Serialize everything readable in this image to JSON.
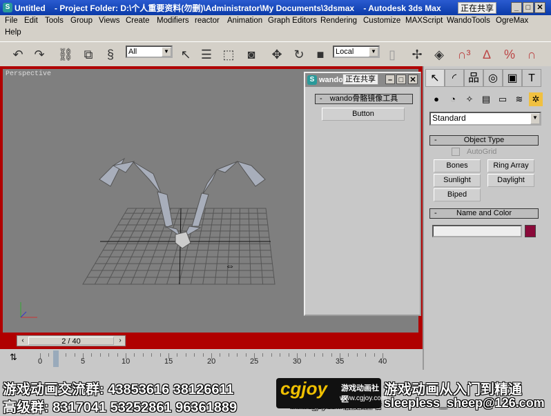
{
  "window": {
    "icon": "3ds-max-icon",
    "title": "Untitled    - Project Folder: D:\\个人重要资料(勿删)\\Administrator\\My Documents\\3dsmax    - Autodesk 3ds Max",
    "share_label": "正在共享"
  },
  "menu": [
    "File",
    "Edit",
    "Tools",
    "Group",
    "Views",
    "Create",
    "Modifiers",
    "reactor",
    "Animation",
    "Graph Editors",
    "Rendering",
    "Customize",
    "MAXScript",
    "WandoTools",
    "OgreMax",
    "Help"
  ],
  "toolbar": {
    "selection_filter": "All",
    "coord_system": "Local",
    "icons": [
      "undo-icon",
      "redo-icon",
      "link-icon",
      "unlink-icon",
      "bind-space-warp-icon",
      "select-icon",
      "select-by-name-icon",
      "rect-region-icon",
      "window-crossing-icon",
      "move-icon",
      "rotate-icon",
      "scale-icon",
      "pivot-icon",
      "manipulate-icon",
      "keyboard-shortcut-icon",
      "snap-3d-icon",
      "angle-snap-icon",
      "percent-snap-icon",
      "spinner-snap-icon"
    ]
  },
  "viewport": {
    "label": "Perspective",
    "frame_counter": "2 / 40",
    "border_color": "#b00000"
  },
  "floater": {
    "title": "wando",
    "share_label": "正在共享",
    "rollout": "wando骨骼镜像工具",
    "button": "Button"
  },
  "command_panel": {
    "dropdown": "Standard",
    "object_type": {
      "title": "Object Type",
      "autogrid": "AutoGrid",
      "autogrid_checked": false,
      "buttons": [
        "Bones",
        "Ring Array",
        "Sunlight",
        "Daylight",
        "Biped"
      ]
    },
    "name_color": {
      "title": "Name and Color",
      "name_value": "",
      "color": "#8a0a3a"
    }
  },
  "timeline": {
    "labels": [
      "0",
      "5",
      "10",
      "15",
      "20",
      "25",
      "30",
      "35",
      "40"
    ],
    "current_frame": 2
  },
  "overlay": {
    "line1": "游戏动画交流群: 43853616   38126611",
    "line2": "高级群: 8317041   53252861   96361889",
    "right1": "游戏动画从入门到精通",
    "right2": "sleepless_sheep@126.com",
    "logo": "cgjoy",
    "logo_sub": "游戏动画社区",
    "logo_url": "www.cgjoy.com",
    "watermark": "www.cgjoy.com 版权归作者"
  }
}
